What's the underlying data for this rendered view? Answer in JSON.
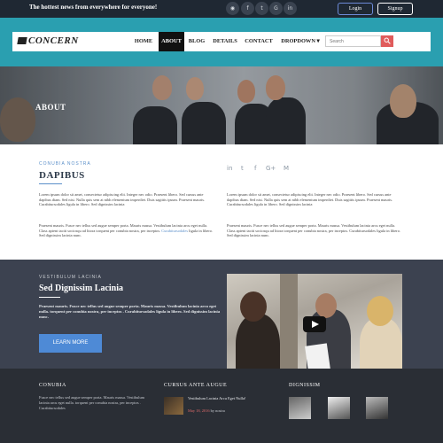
{
  "topbar": {
    "tagline": "The hottest news from everywhere for everyone!",
    "social_icons": [
      "rss-icon",
      "facebook-icon",
      "twitter-icon",
      "google-plus-icon",
      "linkedin-icon"
    ],
    "login_label": "Login",
    "signup_label": "Signup"
  },
  "brand": {
    "name": "CONCERN"
  },
  "nav": {
    "items": [
      "HOME",
      "ABOUT",
      "BLOG",
      "DETAILS",
      "CONTACT",
      "DROPDOWN ▾"
    ],
    "active": "ABOUT"
  },
  "search": {
    "placeholder": "Search"
  },
  "hero": {
    "title": "ABOUT"
  },
  "intro": {
    "eyebrow": "CONUBIA NOSTRA",
    "title": "DAPIBUS",
    "col1_p1": "Lorem ipsum dolor sit amet, consectetur adipiscing elit. Integer nec odio. Praesent libero. Sed cursus ante dapibus diam. Sed nisi. Nulla quis sem at nibh elementum imperdiet. Duis sagittis ipsum. Praesent mauris. Curabitursodales ligula in libero. Sed dignissim lacinia",
    "col1_p2_text": "Praesent mauris. Fusce nec tellus sed augue semper porta. Mauris massa. Vestibulum lacinia arcu eget nulla. Class aptent taciti sociosqu ad litora torquent per conubia nostra, per inceptos.",
    "col1_p2_link": "Curabitursodales",
    "col1_p2_end": "ligula in libero. Sed dignissim lacinia nunc.",
    "col2_p1": "Lorem ipsum dolor sit amet, consectetur adipiscing elit. Integer nec odio. Praesent libero. Sed cursus ante dapibus diam. Sed nisi. Nulla quis sem at nibh elementum imperdiet. Duis sagittis ipsum. Praesent mauris. Curabitursodales ligula in libero. Sed dignissim lacinia",
    "col2_p2": "Praesent mauris. Fusce nec tellus sed augue semper porta. Mauris massa. Vestibulum lacinia arcu eget nulla. Class aptent taciti sociosqu ad litora torquent per conubia nostra, per inceptos. Curabitursodales ligula in libero. Sed dignissim lacinia nunc.",
    "share_icons": [
      "linkedin-icon",
      "twitter-icon",
      "facebook-icon",
      "google-plus-icon",
      "medium-icon"
    ]
  },
  "feature": {
    "eyebrow": "VESTIBULUM LACINIA",
    "title": "Sed Dignissim Lacinia",
    "text": "Praesent mauris. Fusce nec tellus sed augue semper porta. Mauris massa. Vestibulum lacinia arcu eget nulla. torquent per conubia nostra, per inceptos . Curabitursodales ligula in libero. Sed dignissim lacinia nunc.",
    "button_label": "LEARN MORE"
  },
  "footer": {
    "col1_title": "CONUBIA",
    "col1_text": "Fusce nec tellus sed augue semper porta. Mauris massa. Vestibulum lacinia arcu eget nulla. torquent per conubia nostra, per inceptos . Curabitursodales",
    "col2_title": "CURSUS ANTE AUGUE",
    "col2_post_title": "Vestibulum Lacinia Arcu Eget Nulla!",
    "col2_post_date": "May 18, 2016",
    "col2_post_by": "by",
    "col2_post_author": "nostra",
    "col3_title": "DIGNISSIM"
  },
  "colors": {
    "topbar": "#1f2833",
    "teal": "#2a9fb0",
    "accent": "#5b8fc9",
    "feature_bg": "#3c4250",
    "footer_bg": "#2a2e35",
    "button": "#4e8ad6",
    "search_button": "#e05b5b"
  }
}
